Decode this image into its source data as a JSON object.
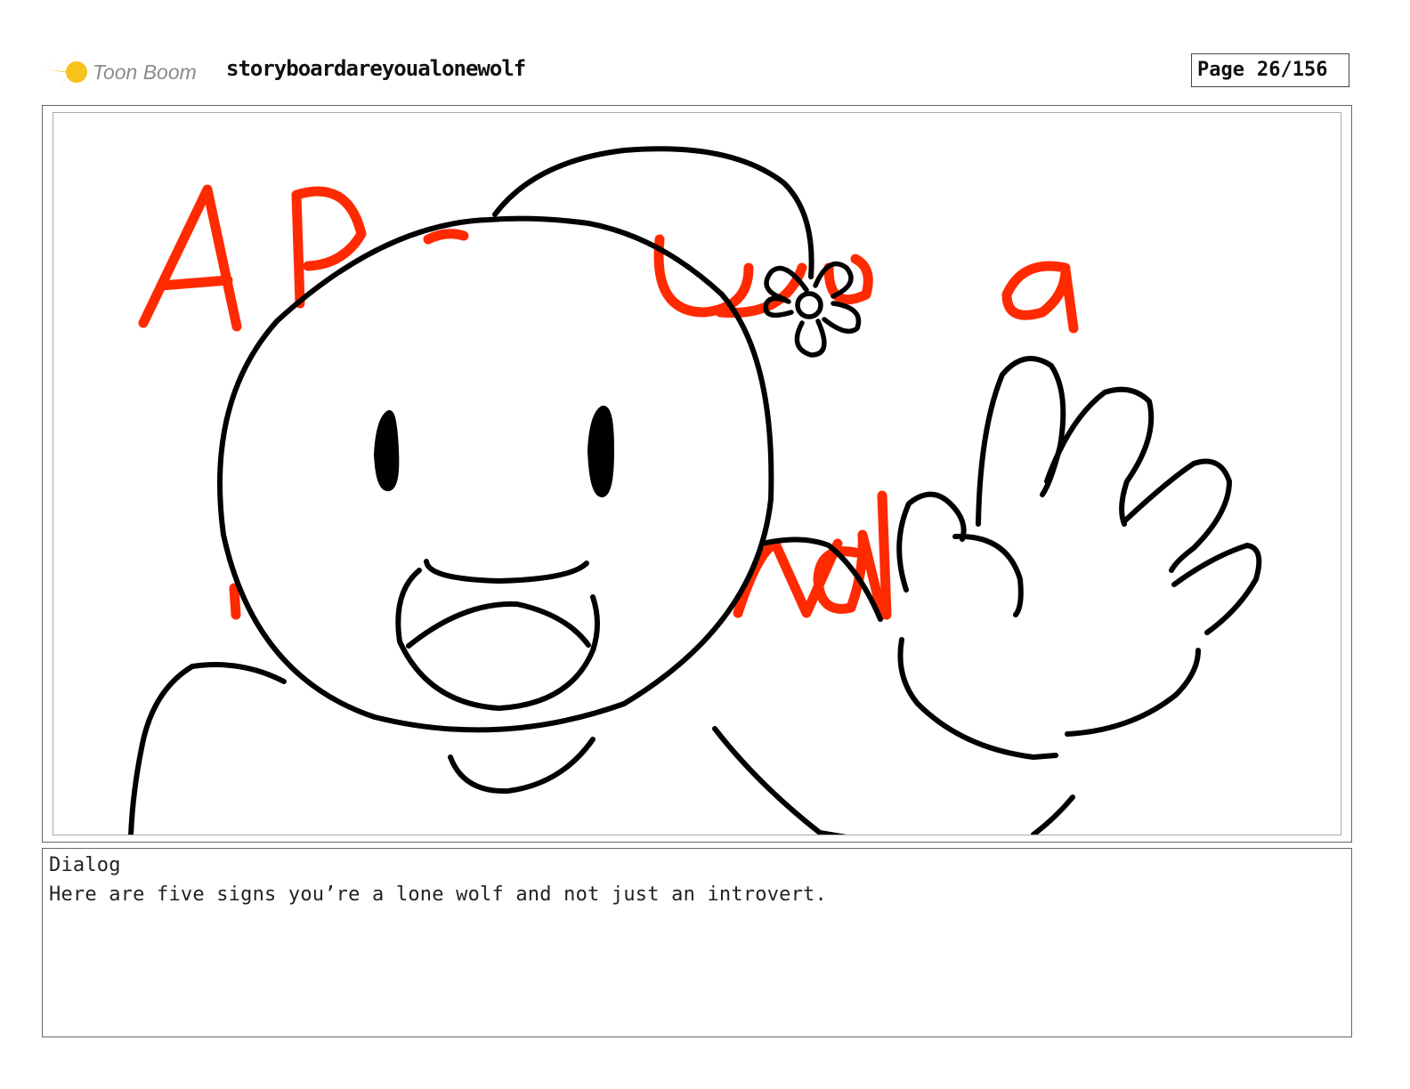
{
  "header": {
    "logo_text": "Toon Boom",
    "project_title": "storyboardareyoualonewolf",
    "page_label": "Page",
    "page_number": "26/156"
  },
  "dialog": {
    "label": "Dialog",
    "text": "Here are five signs you’re a lone wolf and not just an introvert."
  },
  "colors": {
    "logo_yellow": "#f7c21b",
    "logo_grey": "#8a8a8a",
    "sketch_red": "#ff2a00",
    "sketch_black": "#000000",
    "frame_border": "#666666"
  }
}
